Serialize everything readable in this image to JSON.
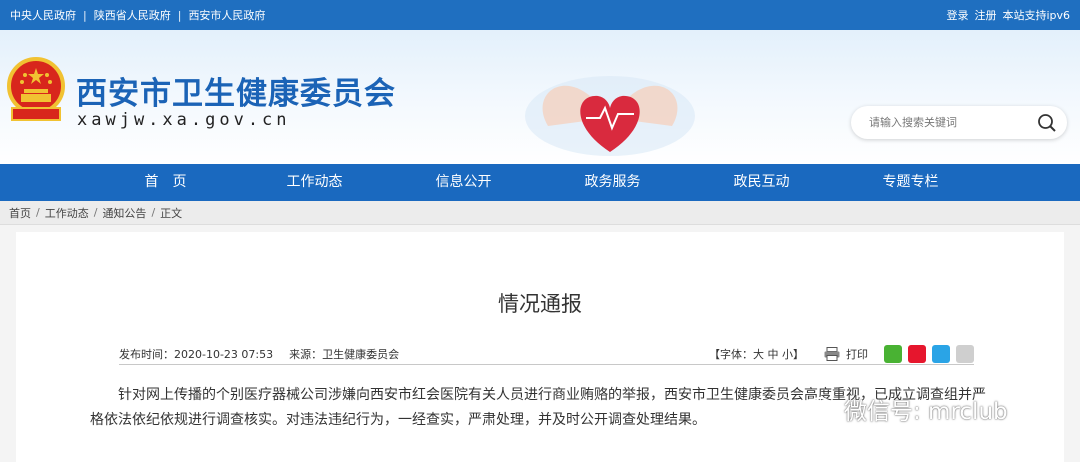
{
  "topbar": {
    "links": [
      "中央人民政府",
      "陕西省人民政府",
      "西安市人民政府"
    ],
    "separator": "|",
    "login": "登录",
    "register": "注册",
    "ipv6": "本站支持ipv6"
  },
  "header": {
    "title": "西安市卫生健康委员会",
    "domain": "xawjw.xa.gov.cn",
    "search_placeholder": "请输入搜索关键词"
  },
  "nav": [
    "首　页",
    "工作动态",
    "信息公开",
    "政务服务",
    "政民互动",
    "专题专栏"
  ],
  "breadcrumb": [
    "首页",
    "工作动态",
    "通知公告",
    "正文"
  ],
  "article": {
    "title": "情况通报",
    "publish_time": "发布时间：2020-10-23 07:53",
    "source": "来源：卫生健康委员会",
    "font_size": "【字体：大 中 小】",
    "print": "打印",
    "body": "针对网上传播的个别医疗器械公司涉嫌向西安市红会医院有关人员进行商业贿赂的举报，西安市卫生健康委员会高度重视，已成立调查组并严格依法依纪依规进行调查核实。对违法违纪行为，一经查实，严肃处理，并及时公开调查处理结果。"
  },
  "watermark": "微信号: mrclub",
  "colors": {
    "primary": "#1a69bf",
    "topbar": "#1f6fc0",
    "title": "#1b63b6"
  },
  "icons": [
    "national-emblem-icon",
    "search-icon",
    "printer-icon",
    "wechat-icon",
    "weibo-icon",
    "qq-icon",
    "copy-icon"
  ]
}
